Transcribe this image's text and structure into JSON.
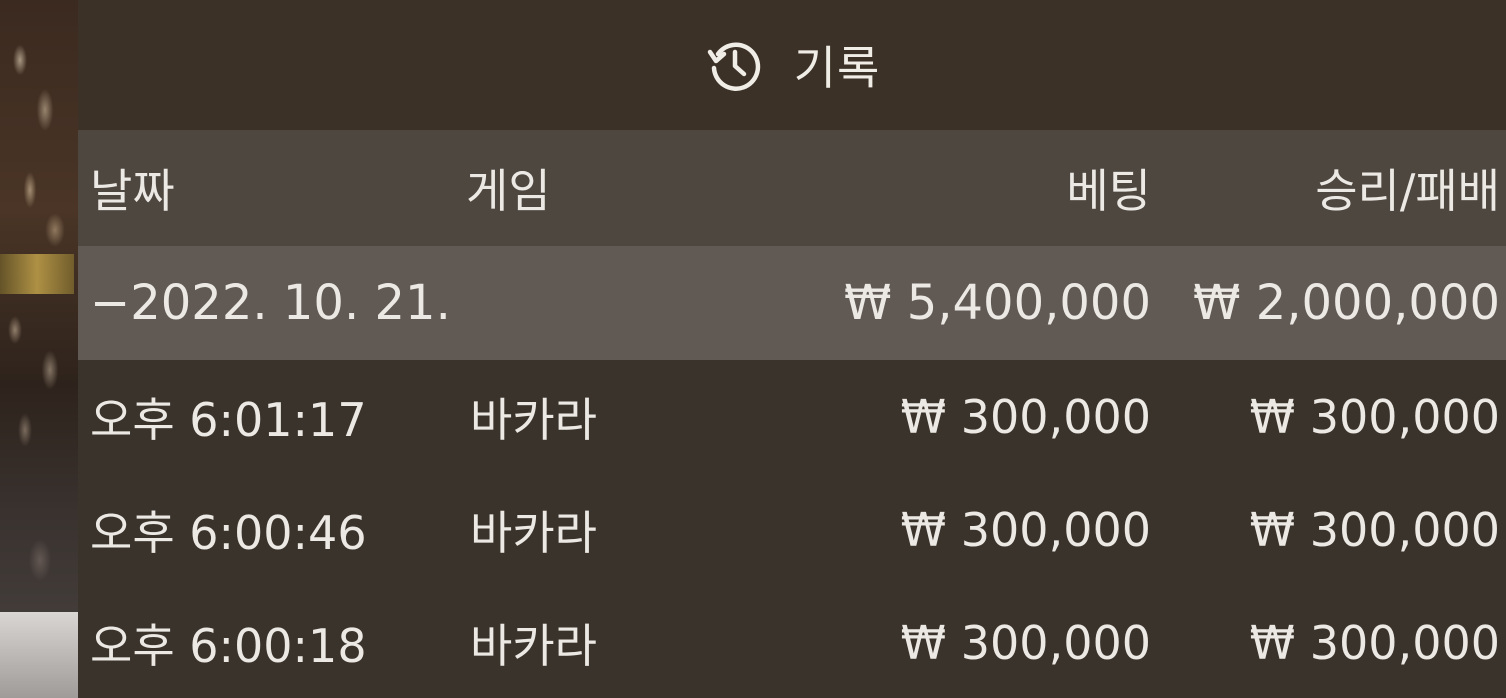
{
  "panel": {
    "title": "기록",
    "icon": "history-icon"
  },
  "columns": {
    "date": "날짜",
    "game": "게임",
    "bet": "베팅",
    "win_loss": "승리/패배"
  },
  "summary": {
    "date": "−2022. 10. 21.",
    "bet": "₩ 5,400,000",
    "win_loss": "₩ 2,000,000"
  },
  "rows": [
    {
      "time": "오후 6:01:17",
      "game": "바카라",
      "bet": "₩ 300,000",
      "win_loss": "₩ 300,000"
    },
    {
      "time": "오후 6:00:46",
      "game": "바카라",
      "bet": "₩ 300,000",
      "win_loss": "₩ 300,000"
    },
    {
      "time": "오후 6:00:18",
      "game": "바카라",
      "bet": "₩ 300,000",
      "win_loss": "₩ 300,000"
    }
  ],
  "colors": {
    "title_bar": "#3b3127",
    "header_row": "#4e4740",
    "summary_row": "#615a54",
    "text": "#ece8e3"
  }
}
